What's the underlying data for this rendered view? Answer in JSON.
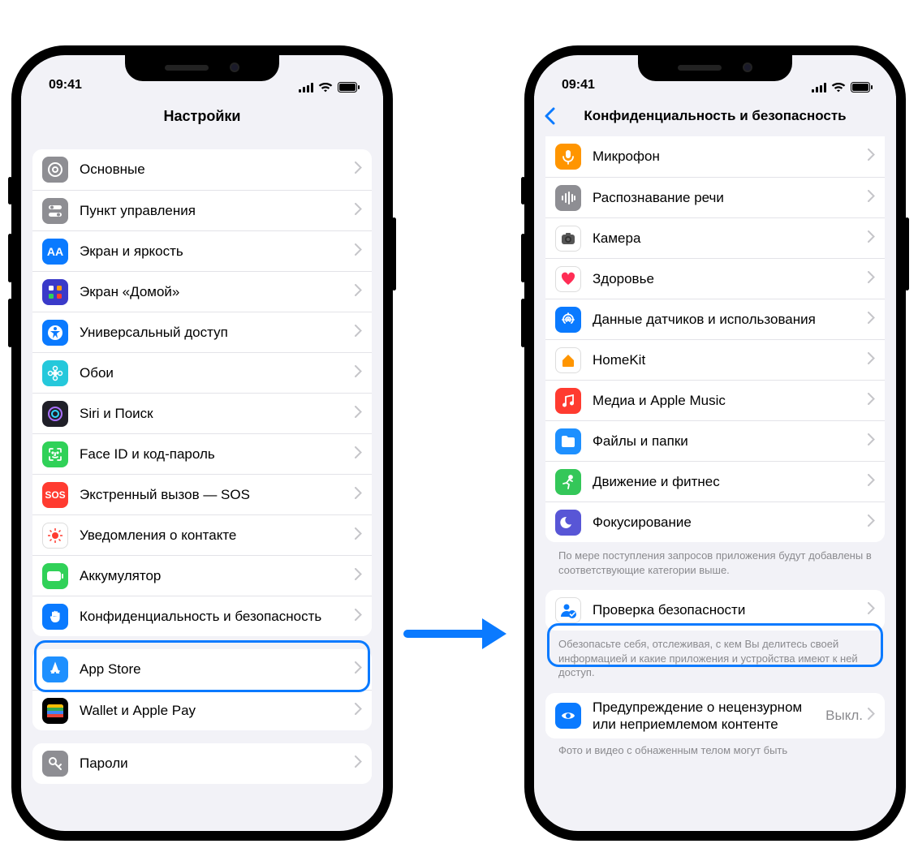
{
  "status": {
    "time": "09:41"
  },
  "screenA": {
    "title": "Настройки",
    "rowsA": [
      {
        "label": "Основные",
        "iconBg": "#8e8e93",
        "glyph": "gear"
      },
      {
        "label": "Пункт управления",
        "iconBg": "#8e8e93",
        "glyph": "switches"
      },
      {
        "label": "Экран и яркость",
        "iconBg": "#0a7aff",
        "glyph": "aa"
      },
      {
        "label": "Экран «Домой»",
        "iconBg": "#3a3ac9",
        "glyph": "grid"
      },
      {
        "label": "Универсальный доступ",
        "iconBg": "#0a7aff",
        "glyph": "accessibility"
      },
      {
        "label": "Обои",
        "iconBg": "#25c8db",
        "glyph": "flower"
      },
      {
        "label": "Siri и Поиск",
        "iconBg": "#1f1f28",
        "glyph": "siri"
      },
      {
        "label": "Face ID и код-пароль",
        "iconBg": "#30d158",
        "glyph": "faceid"
      },
      {
        "label": "Экстренный вызов — SOS",
        "iconBg": "#ff3b30",
        "glyph": "sos"
      },
      {
        "label": "Уведомления о контакте",
        "iconBg": "#ffffff",
        "glyph": "exposure",
        "whiteIcon": true
      },
      {
        "label": "Аккумулятор",
        "iconBg": "#30d158",
        "glyph": "battery"
      },
      {
        "label": "Конфиденциальность и безопасность",
        "iconBg": "#0a7aff",
        "glyph": "hand",
        "twoLine": true
      }
    ],
    "rowsB": [
      {
        "label": "App Store",
        "iconBg": "#1e90ff",
        "glyph": "appstore"
      },
      {
        "label": "Wallet и Apple Pay",
        "iconBg": "#000000",
        "glyph": "wallet"
      }
    ],
    "rowsC": [
      {
        "label": "Пароли",
        "iconBg": "#8e8e93",
        "glyph": "key"
      }
    ]
  },
  "screenB": {
    "title": "Конфиденциальность и безопасность",
    "rowsA": [
      {
        "label": "Микрофон",
        "iconBg": "#ff9500",
        "glyph": "mic"
      },
      {
        "label": "Распознавание речи",
        "iconBg": "#8e8e93",
        "glyph": "wave"
      },
      {
        "label": "Камера",
        "iconBg": "#9a9a9a",
        "glyph": "camera",
        "whiteIcon": true
      },
      {
        "label": "Здоровье",
        "iconBg": "#ffffff",
        "glyph": "heart",
        "whiteIcon": true
      },
      {
        "label": "Данные датчиков и использования",
        "iconBg": "#0a7aff",
        "glyph": "sensor"
      },
      {
        "label": "HomeKit",
        "iconBg": "#ffffff",
        "glyph": "home",
        "whiteIcon": true
      },
      {
        "label": "Медиа и Apple Music",
        "iconBg": "#ff3b30",
        "glyph": "music"
      },
      {
        "label": "Файлы и папки",
        "iconBg": "#1e90ff",
        "glyph": "folder"
      },
      {
        "label": "Движение и фитнес",
        "iconBg": "#34c759",
        "glyph": "run"
      },
      {
        "label": "Фокусирование",
        "iconBg": "#5856d6",
        "glyph": "moon"
      }
    ],
    "footerA": "По мере поступления запросов приложения будут добавлены в соответствующие категории выше.",
    "rowsB": [
      {
        "label": "Проверка безопасности",
        "iconBg": "#ffffff",
        "glyph": "person-check",
        "whiteIcon": true
      }
    ],
    "footerB": "Обезопасьте себя, отслеживая, с кем Вы делитесь своей информацией и какие приложения и устройства имеют к ней доступ.",
    "rowsC": [
      {
        "label": "Предупреждение о нецензурном или неприемлемом контенте",
        "value": "Выкл.",
        "iconBg": "#0a7aff",
        "glyph": "eye"
      }
    ],
    "footerC": "Фото и видео с обнаженным телом могут быть"
  }
}
